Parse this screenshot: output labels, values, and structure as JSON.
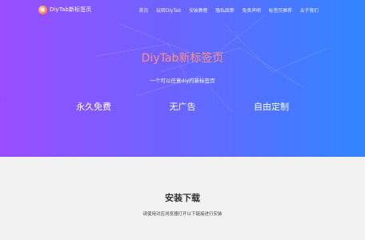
{
  "brand": {
    "name": "DiyTab新标签页",
    "icon": "logo-icon"
  },
  "nav": {
    "items": [
      {
        "label": "首页"
      },
      {
        "label": "玩转DiyTab"
      },
      {
        "label": "安装教程"
      },
      {
        "label": "隐私政策"
      },
      {
        "label": "免责声明"
      },
      {
        "label": "标签页推荐"
      },
      {
        "label": "关于我们"
      }
    ]
  },
  "hero": {
    "title": "DiyTab新标签页",
    "subtitle": "一个可以任意diy的新标签页",
    "features": [
      "永久免费",
      "无广告",
      "自由定制"
    ]
  },
  "install": {
    "title": "安装下载",
    "description": "请使用对应浏览器打开以下链接进行安装"
  },
  "colors": {
    "gradient_start": "#9a4dff",
    "gradient_end": "#2f86ff",
    "title_accent": "#ff8e86",
    "page_background": "#f2f2f2"
  }
}
